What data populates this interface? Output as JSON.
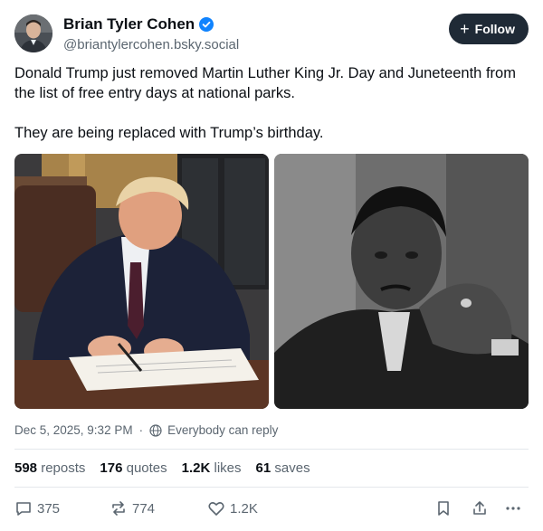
{
  "author": {
    "name": "Brian Tyler Cohen",
    "handle": "@briantylercohen.bsky.social",
    "verified": true
  },
  "follow_label": "Follow",
  "post": {
    "paragraph1": "Donald Trump just removed Martin Luther King Jr. Day and Juneteenth from the list of free entry days at national parks.",
    "paragraph2": "They are being replaced with Trump’s birthday."
  },
  "meta": {
    "timestamp": "Dec 5, 2025, 9:32 PM",
    "reply_setting": "Everybody can reply"
  },
  "stats": {
    "reposts_count": "598",
    "reposts_label": "reposts",
    "quotes_count": "176",
    "quotes_label": "quotes",
    "likes_count": "1.2K",
    "likes_label": "likes",
    "saves_count": "61",
    "saves_label": "saves"
  },
  "actions": {
    "reply_count": "375",
    "repost_count": "774",
    "like_count": "1.2K"
  },
  "icons": [
    "verified-check-icon",
    "plus-icon",
    "globe-icon",
    "reply-icon",
    "repost-icon",
    "heart-icon",
    "bookmark-icon",
    "share-icon",
    "more-icon"
  ],
  "colors": {
    "verified": "#1083fe",
    "follow_button": "#1f2a36",
    "muted_text": "#5b6670"
  }
}
